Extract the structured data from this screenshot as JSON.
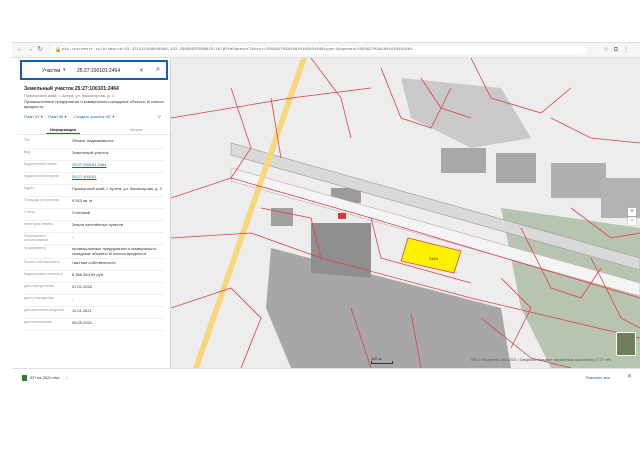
{
  "browser": {
    "url": "pkk.rosreestr.ru/#/search/43.371531368649889,132.29698925589825/16/@?fa5aeesvf7&text=25%3A27%3A100101%3A2464&type=1&opened=25%3A27%3A100101%3A2464",
    "back_glyph": "←",
    "forward_glyph": "→",
    "reload_glyph": "↻",
    "lock_glyph": "🔒"
  },
  "search": {
    "type_label": "Участки",
    "caret": "▾",
    "query": "25:27:100101:2464",
    "clear_glyph": "✕",
    "search_glyph": "⌕"
  },
  "card": {
    "title": "Земельный участок 25:27:100101:2464",
    "address_short": "Приморский край, г. Артем, ул. Кашихорова, д. 3",
    "purpose": "Промышленные предприятия и коммунально-складские объекты III класса вредности"
  },
  "actions": {
    "plan_label": "План ЗУ ▾",
    "plan_kk_label": "План КК ▾",
    "create_label": "Создать участок НС ▾"
  },
  "tabs": [
    {
      "label": "Информация"
    },
    {
      "label": "Услуги"
    }
  ],
  "info_rows": [
    {
      "label": "Тип",
      "value": "Объект недвижимости"
    },
    {
      "label": "Вид",
      "value": "Земельный участок"
    },
    {
      "label": "Кадастровый номер",
      "value": "25:27:100101:2464"
    },
    {
      "label": "Кадастровый квартал",
      "value": "25:27:100101"
    },
    {
      "label": "Адрес",
      "value": "Приморский край, г. Артем, ул. Кашихорова, д. 3"
    },
    {
      "label": "Площадь уточненная",
      "value": "9 523 кв. м"
    },
    {
      "label": "Статус",
      "value": "Учтенный"
    },
    {
      "label": "Категория земель",
      "value": "Земли населённых пунктов"
    },
    {
      "label": "Разрешенное использование",
      "value": "-"
    },
    {
      "label": "по документу",
      "value": "промышленные предприятия и коммунально-складские объекты III класса вредности"
    },
    {
      "label": "Форма собственности",
      "value": "Частная собственность"
    },
    {
      "label": "Кадастровая стоимость",
      "value": "8 386 954,69 руб."
    },
    {
      "label": "дата определения",
      "value": "01.01.2020"
    },
    {
      "label": "дата утверждения",
      "value": "-"
    },
    {
      "label": "дата внесения сведений",
      "value": "11.01.2021"
    },
    {
      "label": "дата применения",
      "value": "05.05.2021"
    }
  ],
  "map": {
    "scale_label": "100 м",
    "attribution": "ПКК © Росреестр 2010-2021 | Сведения обладают справочным характером | © ГУ «Роскадастр» 2021",
    "highlight_label": "2464",
    "zoom_in": "+",
    "zoom_out": "−",
    "colors": {
      "boundary": "#e0404a",
      "highlight": "#fff200",
      "road": "#f6d77a",
      "built": "#9a9a9a"
    }
  },
  "downloads": {
    "file_name": "ATI на 2020.xlsx",
    "show_all": "Показать все",
    "close_glyph": "✕"
  }
}
